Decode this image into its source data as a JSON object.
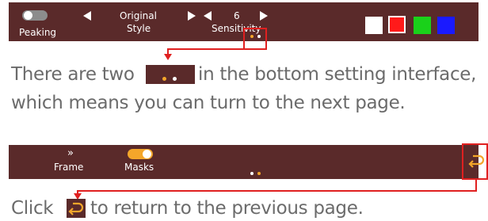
{
  "top_panel": {
    "peaking_label": "Peaking",
    "style_label_line1": "Original",
    "style_label_line2": "Style",
    "sensitivity_value": "6",
    "sensitivity_label": "Sensitivity",
    "colors": [
      "#ffffff",
      "#ff1a1a",
      "#1ad11a",
      "#1a1aff"
    ],
    "selected_color_index": 1
  },
  "caption1": {
    "before": "There are two",
    "after": "in the bottom setting interface,",
    "line2": "which means you can turn to the next page."
  },
  "bottom_panel": {
    "frame_icon": "»",
    "frame_label": "Frame",
    "masks_label": "Masks"
  },
  "caption2": {
    "before": "Click",
    "after": "to return to the previous page."
  },
  "colors": {
    "panel_bg": "#5a2a2a",
    "accent_orange": "#f4a62a",
    "highlight_red": "#e02020",
    "caption_text": "#6b6b6b"
  },
  "icons": [
    "peaking-toggle",
    "arrow-left-icon",
    "arrow-right-icon",
    "page-dots-icon",
    "frame-icon",
    "masks-toggle",
    "back-icon"
  ]
}
